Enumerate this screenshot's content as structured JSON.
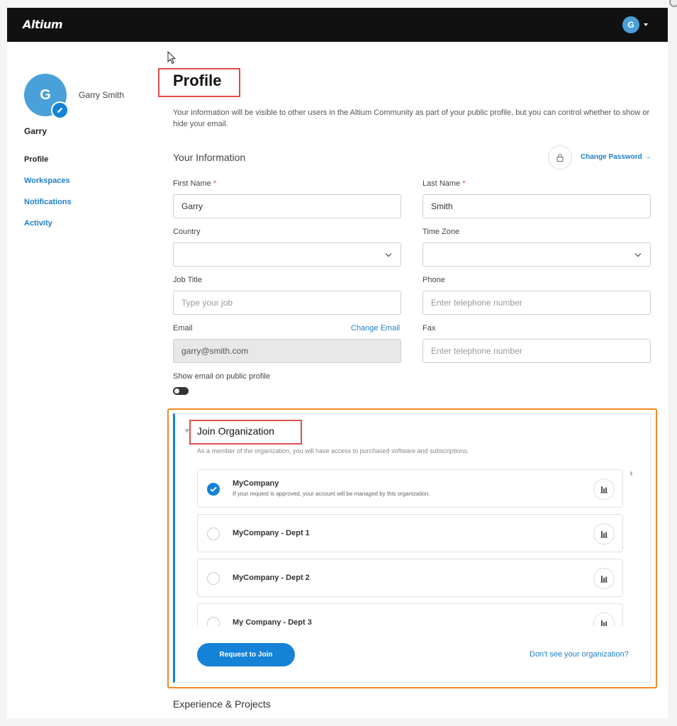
{
  "header": {
    "logo": "Altium",
    "user_initial": "G"
  },
  "sidebar": {
    "avatar_initial": "G",
    "full_name": "Garry Smith",
    "short_name": "Garry",
    "nav": [
      {
        "label": "Profile",
        "active": true
      },
      {
        "label": "Workspaces",
        "active": false
      },
      {
        "label": "Notifications",
        "active": false
      },
      {
        "label": "Activity",
        "active": false
      }
    ]
  },
  "main": {
    "title": "Profile",
    "intro": "Your information will be visible to other users in the Altium Community as part of your public profile, but you can control whether to show or hide your email.",
    "your_info": "Your Information",
    "change_password": "Change Password →",
    "fields": {
      "first_name": {
        "label": "First Name",
        "required": "*",
        "value": "Garry"
      },
      "last_name": {
        "label": "Last Name",
        "required": "*",
        "value": "Smith"
      },
      "country": {
        "label": "Country"
      },
      "time_zone": {
        "label": "Time Zone"
      },
      "job_title": {
        "label": "Job Title",
        "placeholder": "Type your job"
      },
      "phone": {
        "label": "Phone",
        "placeholder": "Enter telephone number"
      },
      "email": {
        "label": "Email",
        "value": "garry@smith.com",
        "change_link": "Change Email"
      },
      "fax": {
        "label": "Fax",
        "placeholder": "Enter telephone number"
      }
    },
    "show_email": {
      "label": "Show email on public profile",
      "enabled": false
    }
  },
  "org": {
    "title": "Join Organization",
    "description": "As a member of the organization, you will have access to purchased software and subscriptions.",
    "items": [
      {
        "name": "MyCompany",
        "note": "If your request is approved, your account will be managed by this organization.",
        "selected": true
      },
      {
        "name": "MyCompany - Dept 1",
        "selected": false
      },
      {
        "name": "MyCompany - Dept 2",
        "selected": false
      },
      {
        "name": "My Company - Dept 3",
        "selected": false
      }
    ],
    "join_button": "Request to Join",
    "dont_see": "Don't see your organization?"
  },
  "experience": {
    "title": "Experience & Projects"
  },
  "colors": {
    "accent": "#1482d6",
    "link": "#1e7fc9",
    "highlight_red": "#e24c4c",
    "highlight_orange": "#f08a24",
    "topbar": "#111111"
  },
  "icons": [
    "pencil-icon",
    "lock-icon",
    "chevron-down-icon",
    "check-icon",
    "building-icon",
    "cursor-icon"
  ]
}
